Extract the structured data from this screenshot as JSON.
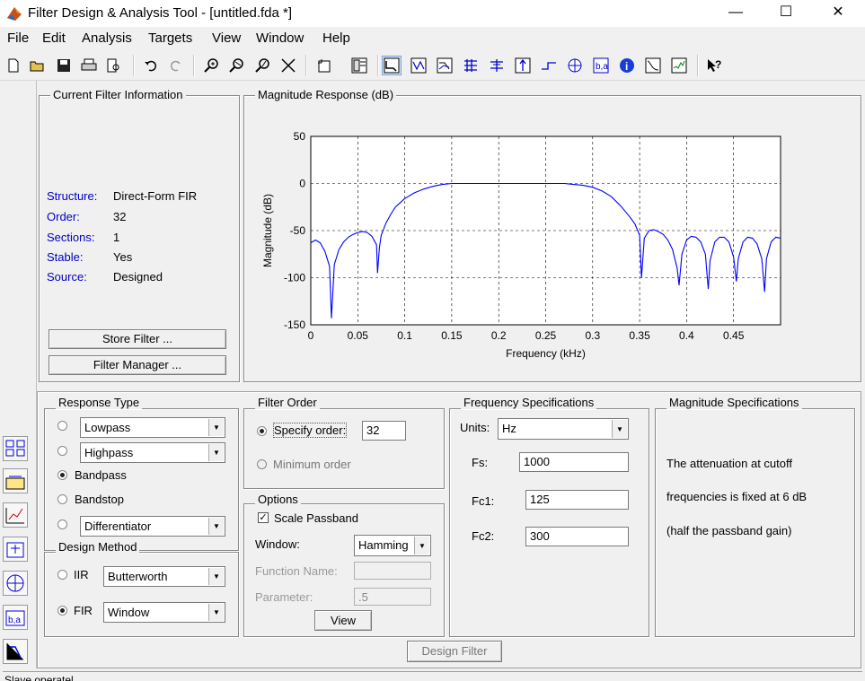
{
  "window": {
    "title": "Filter Design & Analysis Tool -  [untitled.fda *]",
    "minimize": "—",
    "maximize": "☐",
    "close": "✕"
  },
  "menu": [
    "File",
    "Edit",
    "Analysis",
    "Targets",
    "View",
    "Window",
    "Help"
  ],
  "toolbar": {
    "icons": [
      "new-icon",
      "open-icon",
      "save-icon",
      "print-icon",
      "print-preview-icon",
      "undo-icon",
      "redo-icon",
      "zoom-in-icon",
      "zoom-x-icon",
      "zoom-y-icon",
      "full-view-icon",
      "new-figure-icon",
      "fullscreen-icon",
      "magnitude-response-icon",
      "phase-response-icon",
      "mag-phase-icon",
      "group-delay-icon",
      "phase-delay-icon",
      "impulse-response-icon",
      "step-response-icon",
      "pole-zero-icon",
      "coefficients-icon",
      "filter-info-icon",
      "magnitude-estimate-icon",
      "round-off-noise-icon",
      "whats-this-icon"
    ],
    "pressed": "magnitude-response-icon"
  },
  "info": {
    "title": "Current Filter Information",
    "rows": [
      {
        "label": "Structure:",
        "value": "Direct-Form FIR"
      },
      {
        "label": "Order:",
        "value": "32"
      },
      {
        "label": "Sections:",
        "value": "1"
      },
      {
        "label": "Stable:",
        "value": "Yes"
      },
      {
        "label": "Source:",
        "value": "Designed"
      }
    ],
    "store_button": "Store Filter ...",
    "manager_button": "Filter Manager ..."
  },
  "plot": {
    "title": "Magnitude Response (dB)",
    "color": "#0000ff"
  },
  "chart_data": {
    "type": "line",
    "xlabel": "Frequency (kHz)",
    "ylabel": "Magnitude (dB)",
    "xlim": [
      0,
      0.5
    ],
    "ylim": [
      -150,
      50
    ],
    "xticks": [
      "0",
      "0.05",
      "0.1",
      "0.15",
      "0.2",
      "0.25",
      "0.3",
      "0.35",
      "0.4",
      "0.45"
    ],
    "xtick_values": [
      0,
      0.05,
      0.1,
      0.15,
      0.2,
      0.25,
      0.3,
      0.35,
      0.4,
      0.45
    ],
    "yticks": [
      "50",
      "0",
      "-50",
      "-100",
      "-150"
    ],
    "ytick_values": [
      50,
      0,
      -50,
      -100,
      -150
    ],
    "grid": true,
    "series": [
      {
        "x": [
          0,
          0.005,
          0.01,
          0.015,
          0.02,
          0.022,
          0.025,
          0.03,
          0.035,
          0.04,
          0.045,
          0.05,
          0.055,
          0.06,
          0.065,
          0.07,
          0.071,
          0.073,
          0.075,
          0.08,
          0.085,
          0.09,
          0.1,
          0.11,
          0.12,
          0.13,
          0.14,
          0.15,
          0.16,
          0.2,
          0.25,
          0.27,
          0.28,
          0.29,
          0.3,
          0.31,
          0.32,
          0.33,
          0.34,
          0.345,
          0.35,
          0.352,
          0.355,
          0.36,
          0.365,
          0.37,
          0.375,
          0.38,
          0.385,
          0.39,
          0.392,
          0.395,
          0.4,
          0.405,
          0.41,
          0.415,
          0.42,
          0.423,
          0.425,
          0.43,
          0.435,
          0.44,
          0.445,
          0.45,
          0.453,
          0.455,
          0.46,
          0.465,
          0.47,
          0.475,
          0.48,
          0.483,
          0.485,
          0.49,
          0.495,
          0.5
        ],
        "y": [
          -63,
          -60,
          -63,
          -72,
          -88,
          -143,
          -86,
          -70,
          -62,
          -57,
          -54,
          -52,
          -51,
          -52,
          -56,
          -65,
          -95,
          -68,
          -55,
          -42,
          -33,
          -25,
          -16,
          -10,
          -6,
          -3,
          -1,
          0,
          0,
          0,
          0,
          0,
          -1,
          -2,
          -4,
          -8,
          -14,
          -24,
          -36,
          -43,
          -55,
          -100,
          -58,
          -50,
          -49,
          -51,
          -54,
          -60,
          -70,
          -90,
          -108,
          -75,
          -60,
          -56,
          -57,
          -62,
          -75,
          -112,
          -82,
          -62,
          -57,
          -57,
          -62,
          -78,
          -104,
          -80,
          -62,
          -57,
          -58,
          -64,
          -80,
          -115,
          -80,
          -62,
          -57,
          -58
        ]
      }
    ]
  },
  "response_type": {
    "title": "Response Type",
    "options": [
      {
        "kind": "combo",
        "value": "Lowpass",
        "selected": false
      },
      {
        "kind": "combo",
        "value": "Highpass",
        "selected": false
      },
      {
        "kind": "label",
        "value": "Bandpass",
        "selected": true
      },
      {
        "kind": "label",
        "value": "Bandstop",
        "selected": false
      },
      {
        "kind": "combo",
        "value": "Differentiator",
        "selected": false
      }
    ]
  },
  "design_method": {
    "title": "Design Method",
    "iir_label": "IIR",
    "iir_value": "Butterworth",
    "fir_label": "FIR",
    "fir_value": "Window",
    "selected": "FIR"
  },
  "filter_order": {
    "title": "Filter Order",
    "specify_label": "Specify order:",
    "specify_value": "32",
    "minimum_label": "Minimum order",
    "selected": "specify"
  },
  "options": {
    "title": "Options",
    "scale_label": "Scale Passband",
    "scale_checked": true,
    "window_label": "Window:",
    "window_value": "Hamming",
    "function_label": "Function Name:",
    "function_value": "",
    "parameter_label": "Parameter:",
    "parameter_value": ".5",
    "view_button": "View"
  },
  "freq_specs": {
    "title": "Frequency Specifications",
    "units_label": "Units:",
    "units_value": "Hz",
    "fs_label": "Fs:",
    "fs_value": "1000",
    "fc1_label": "Fc1:",
    "fc1_value": "125",
    "fc2_label": "Fc2:",
    "fc2_value": "300"
  },
  "mag_specs": {
    "title": "Magnitude Specifications",
    "lines": [
      "The attenuation at cutoff",
      "frequencies is fixed at 6 dB",
      "(half the passband gain)"
    ]
  },
  "design_button": "Design Filter",
  "status": {
    "text": "Slave operatel"
  },
  "sidebar": [
    "transform-filter-icon",
    "realize-model-icon",
    "pole-zero-editor-icon",
    "import-filter-icon",
    "multirate-icon",
    "quantize-icon",
    "design-filter-icon"
  ]
}
